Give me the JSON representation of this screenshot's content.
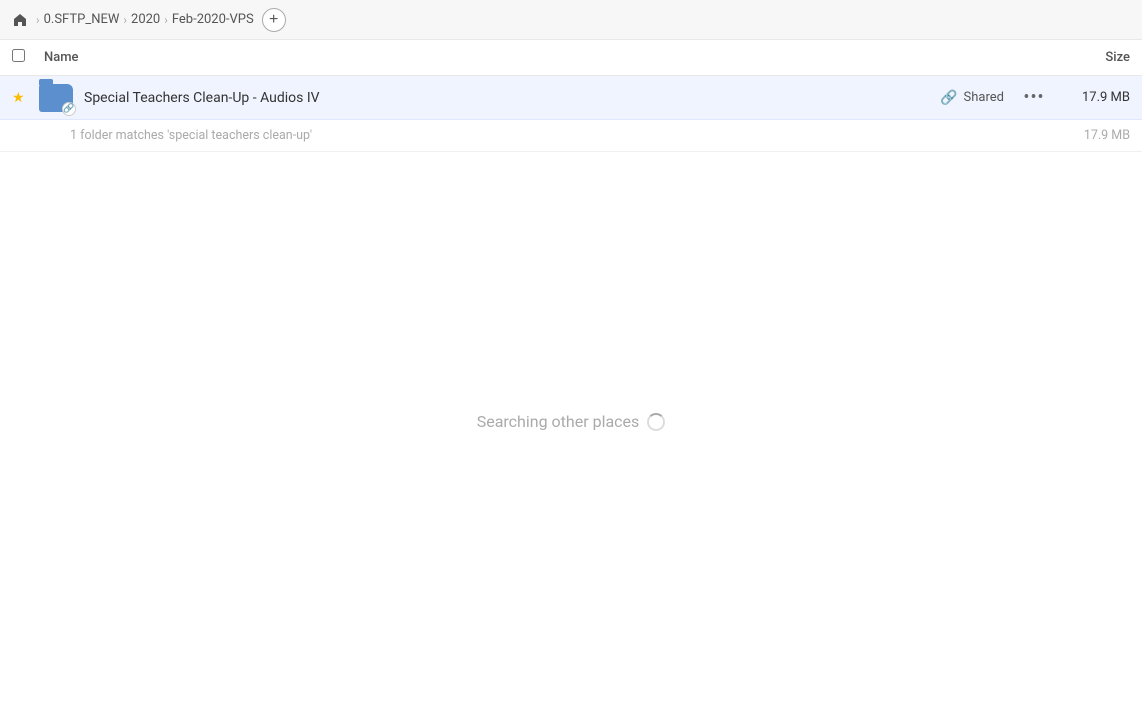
{
  "breadcrumb": {
    "home_icon": "home",
    "items": [
      {
        "label": "0.SFTP_NEW",
        "id": "sftp-new"
      },
      {
        "label": "2020",
        "id": "2020"
      },
      {
        "label": "Feb-2020-VPS",
        "id": "feb-2020-vps"
      }
    ],
    "add_button_label": "+"
  },
  "columns": {
    "name_label": "Name",
    "size_label": "Size"
  },
  "file_row": {
    "star": "★",
    "name": "Special Teachers Clean-Up - Audios IV",
    "shared_icon": "🔗",
    "shared_label": "Shared",
    "more_icon": "•••",
    "size": "17.9 MB"
  },
  "summary": {
    "text": "1 folder matches 'special teachers clean-up'",
    "size": "17.9 MB"
  },
  "searching": {
    "text": "Searching other places"
  }
}
